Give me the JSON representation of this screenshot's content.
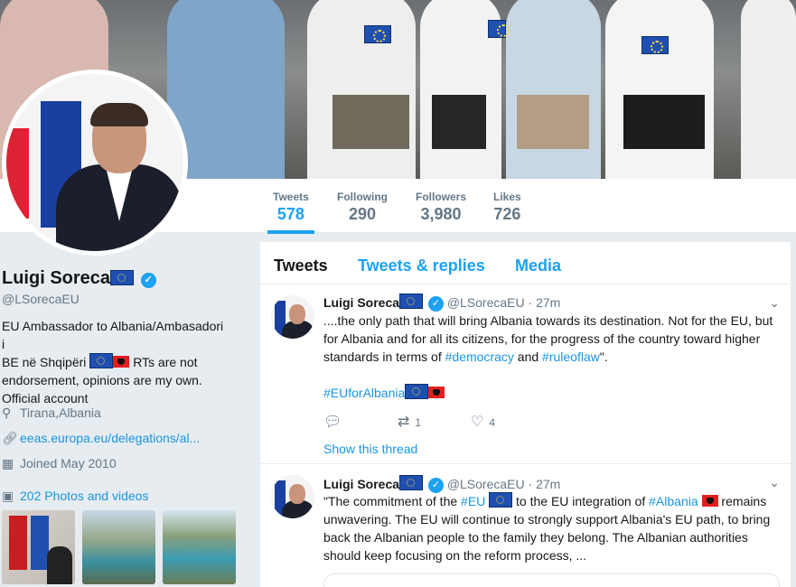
{
  "stats": {
    "tweets": {
      "label": "Tweets",
      "value": "578"
    },
    "following": {
      "label": "Following",
      "value": "290"
    },
    "followers": {
      "label": "Followers",
      "value": "3,980"
    },
    "likes": {
      "label": "Likes",
      "value": "726"
    }
  },
  "profile": {
    "name": "Luigi Soreca",
    "handle": "@LSorecaEU",
    "bio_line1": "EU Ambassador to Albania/Ambasadori i",
    "bio_line2_a": "BE në Shqipëri",
    "bio_line2_b": "RTs are not",
    "bio_line3": "endorsement, opinions are my own.",
    "bio_line4": "Official account",
    "location": "Tirana,Albania",
    "website": "eeas.europa.eu/delegations/al...",
    "joined": "Joined May 2010",
    "photos": "202 Photos and videos"
  },
  "tabs": {
    "tweets": "Tweets",
    "replies": "Tweets & replies",
    "media": "Media"
  },
  "tweets": [
    {
      "name": "Luigi Soreca",
      "handle": "@LSorecaEU",
      "time": "27m",
      "text_l1": "....the only path that will bring Albania towards its destination. Not for the EU, but",
      "text_l2": "for Albania and for all its citizens, for the progress of the country toward higher",
      "text_l3_a": "standards in terms of",
      "hash1": "#democracy",
      "text_l3_b": "and",
      "hash2": "#ruleoflaw",
      "text_l3_c": "\".",
      "hash3": "#EUforAlbania",
      "retweets": "1",
      "likes": "4",
      "show_thread": "Show this thread"
    },
    {
      "name": "Luigi Soreca",
      "handle": "@LSorecaEU",
      "time": "27m",
      "text_l1_a": "\"The commitment of the",
      "hash1": "#EU",
      "text_l1_b": "to the EU integration of",
      "hash2": "#Albania",
      "text_l1_c": "remains",
      "text_l2": "unwavering. The EU will continue to strongly support Albania's EU path, to bring",
      "text_l3": "back the Albanian people to the family they belong. The Albanian authorities",
      "text_l4": "should keep focusing on the reform process, ..."
    }
  ],
  "colors": {
    "accent": "#1da1f2",
    "link": "#1b95e0",
    "muted": "#657786",
    "background": "#e6ecf0"
  },
  "icons": {
    "location": "location-pin-icon",
    "link": "link-icon",
    "calendar": "calendar-icon",
    "photos": "image-icon",
    "reply": "reply-icon",
    "retweet": "retweet-icon",
    "like": "heart-icon",
    "caret": "chevron-down-icon",
    "verified": "verified-badge-icon"
  }
}
